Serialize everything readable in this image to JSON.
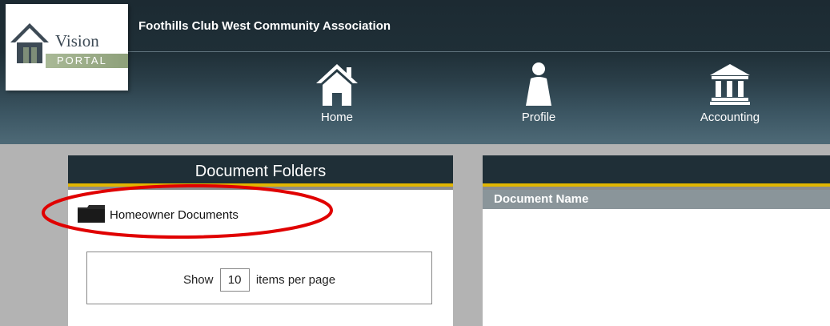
{
  "header": {
    "org_title": "Foothills Club West Community Association"
  },
  "logo": {
    "vision": "Vision",
    "portal": "PORTAL",
    "icon": "house-logo-icon"
  },
  "nav": [
    {
      "label": "Home",
      "icon": "home-icon"
    },
    {
      "label": "Profile",
      "icon": "profile-icon"
    },
    {
      "label": "Accounting",
      "icon": "bank-icon"
    }
  ],
  "folders_panel": {
    "title": "Document Folders",
    "folders": [
      {
        "label": "Homeowner Documents",
        "icon": "folder-icon"
      }
    ],
    "pager": {
      "show_label": "Show",
      "page_size": "10",
      "suffix_label": "items per page"
    }
  },
  "documents_panel": {
    "column_header": "Document Name"
  },
  "colors": {
    "header_dark": "#1f2f37",
    "accent_yellow": "#e2b600",
    "annotation_red": "#e00000",
    "content_bg": "#b3b3b3"
  }
}
